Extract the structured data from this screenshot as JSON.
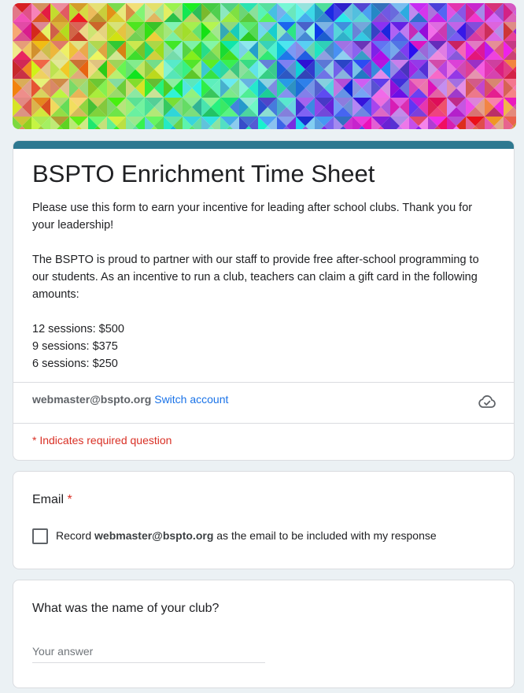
{
  "banner": {
    "description_icon": "colorful-triangle-mosaic"
  },
  "form": {
    "title": "BSPTO Enrichment Time Sheet",
    "description": {
      "intro": "Please use this form to earn your incentive for leading after school clubs. Thank you for your leadership!",
      "details": "The BSPTO is proud to partner with our staff to provide free after-school programming to our students. As an incentive to run a club, teachers can claim a gift card in the following amounts:",
      "amounts": [
        "12 sessions: $500",
        "9 sessions: $375",
        "6 sessions: $250"
      ]
    },
    "account": {
      "email": "webmaster@bspto.org",
      "switch_label": "Switch account",
      "save_status_icon": "cloud-check-icon"
    },
    "required_note": "* Indicates required question",
    "accent_color": "#2e7890"
  },
  "questions": {
    "email": {
      "title": "Email",
      "required_marker": "*",
      "checkbox_prefix": "Record",
      "checkbox_email": "webmaster@bspto.org",
      "checkbox_suffix": "as the email to be included with my response",
      "checked": false
    },
    "club_name": {
      "title": "What was the name of your club?",
      "placeholder": "Your answer",
      "value": ""
    }
  }
}
